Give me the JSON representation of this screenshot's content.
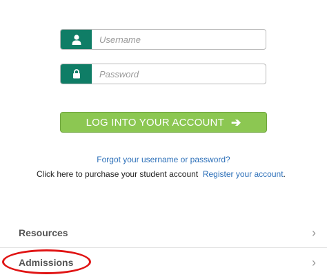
{
  "login": {
    "username_placeholder": "Username",
    "password_placeholder": "Password",
    "button_label": "LOG INTO YOUR ACCOUNT",
    "forgot_link": "Forgot your username or password?",
    "purchase_text": "Click here to purchase your student account",
    "register_link": "Register your account",
    "register_suffix": "."
  },
  "accordion": [
    {
      "label": "Resources"
    },
    {
      "label": "Admissions"
    }
  ],
  "colors": {
    "icon_bg": "#0f7d66",
    "button_bg": "#8cc752",
    "link": "#2a6eb8",
    "highlight": "#e01414"
  },
  "icons": {
    "username": "user-icon",
    "password": "lock-icon",
    "button": "arrow-right-icon",
    "chevron": "chevron-right-icon"
  }
}
